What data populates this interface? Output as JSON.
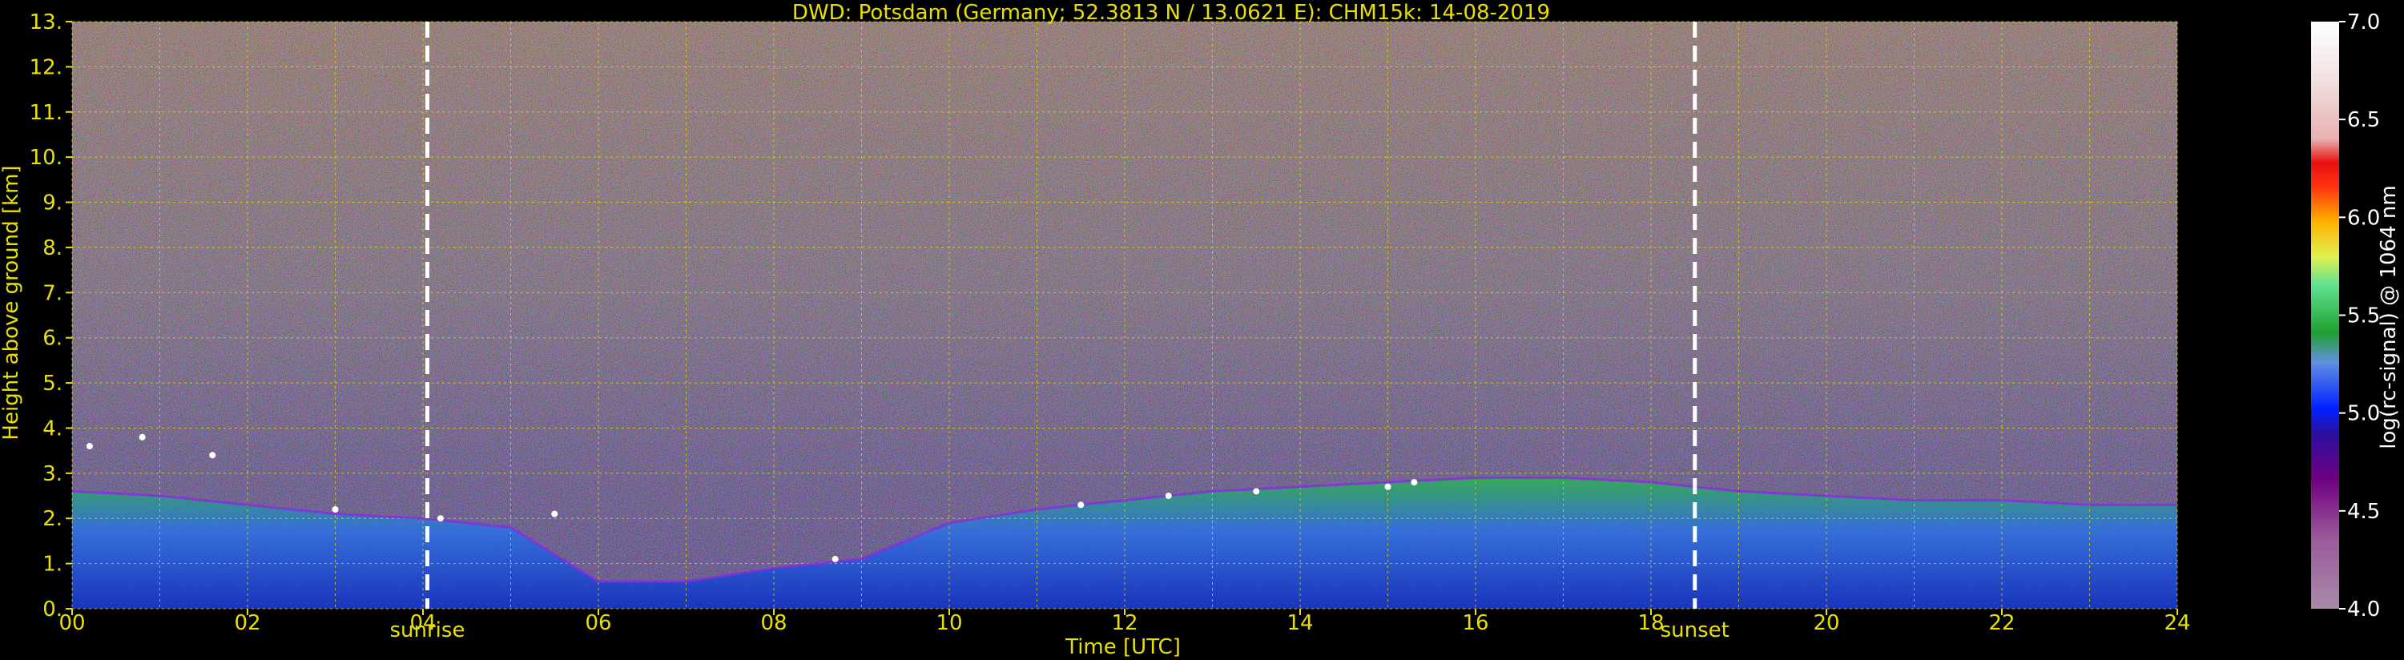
{
  "chart_data": {
    "type": "heatmap",
    "title": "DWD: Potsdam (Germany; 52.3813 N / 13.0621 E):    CHM15k: 14-08-2019",
    "xlabel": "Time [UTC]",
    "ylabel": "Height above ground [km]",
    "xlim": [
      0,
      24
    ],
    "ylim": [
      0,
      13
    ],
    "x_ticks": [
      "00",
      "02",
      "04",
      "06",
      "08",
      "10",
      "12",
      "14",
      "16",
      "18",
      "20",
      "22",
      "24"
    ],
    "y_ticks": [
      "0.",
      "1.",
      "2.",
      "3.",
      "4.",
      "5.",
      "6.",
      "7.",
      "8.",
      "9.",
      "10.",
      "11.",
      "12.",
      "13."
    ],
    "grid": true,
    "annotations": [
      {
        "text": "sunrise",
        "x": 4.05
      },
      {
        "text": "sunset",
        "x": 18.5
      }
    ],
    "colorbar": {
      "label": "log(rc-signal) @ 1064 nm",
      "range": [
        4.0,
        7.0
      ],
      "ticks": [
        "4.0",
        "4.5",
        "5.0",
        "5.5",
        "6.0",
        "6.5",
        "7.0"
      ]
    },
    "layers": {
      "boundary_layer_top_km": [
        [
          0.0,
          2.6
        ],
        [
          1.0,
          2.5
        ],
        [
          2.0,
          2.3
        ],
        [
          3.0,
          2.1
        ],
        [
          4.0,
          2.0
        ],
        [
          5.0,
          1.8
        ],
        [
          6.0,
          0.6
        ],
        [
          7.0,
          0.6
        ],
        [
          8.0,
          0.9
        ],
        [
          9.0,
          1.1
        ],
        [
          10.0,
          1.9
        ],
        [
          11.0,
          2.2
        ],
        [
          12.0,
          2.4
        ],
        [
          13.0,
          2.6
        ],
        [
          14.0,
          2.7
        ],
        [
          15.0,
          2.8
        ],
        [
          16.0,
          2.9
        ],
        [
          17.0,
          2.9
        ],
        [
          18.0,
          2.8
        ],
        [
          19.0,
          2.6
        ],
        [
          20.0,
          2.5
        ],
        [
          21.0,
          2.4
        ],
        [
          22.0,
          2.4
        ],
        [
          23.0,
          2.3
        ],
        [
          24.0,
          2.3
        ]
      ],
      "cloud_tops_km": [
        [
          0.2,
          3.6
        ],
        [
          0.8,
          3.8
        ],
        [
          1.6,
          3.4
        ],
        [
          3.0,
          2.2
        ],
        [
          4.2,
          2.0
        ],
        [
          5.5,
          2.1
        ],
        [
          8.7,
          1.1
        ],
        [
          11.5,
          2.3
        ],
        [
          12.5,
          2.5
        ],
        [
          13.5,
          2.6
        ],
        [
          15.0,
          2.7
        ],
        [
          15.3,
          2.8
        ]
      ]
    }
  }
}
